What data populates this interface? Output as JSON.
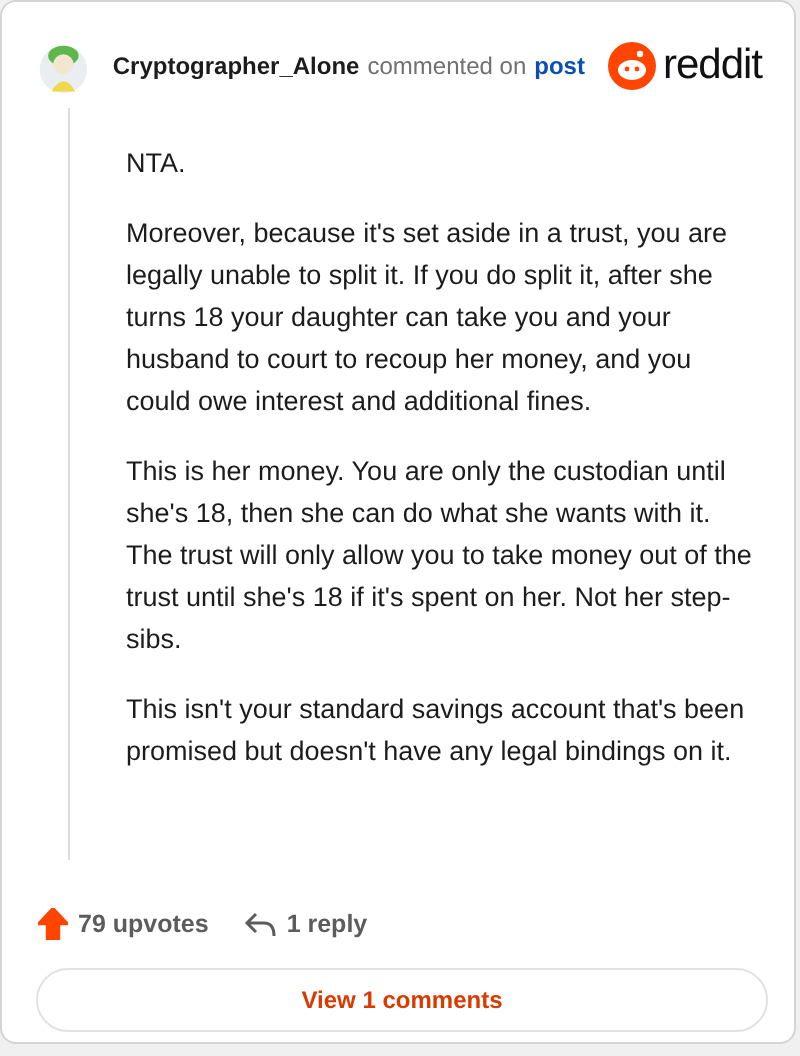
{
  "header": {
    "username": "Cryptographer_Alone",
    "action": "commented on",
    "link": "post",
    "brand": "reddit"
  },
  "paragraphs": [
    "NTA.",
    "Moreover, because it's set aside in a trust, you are legally unable to split it. If you do split it, after she turns 18 your daughter can take you and your husband to court to recoup her money, and you could owe interest and additional fines.",
    "This is her money. You are only the custodian until she's 18, then she can do what she wants with it. The trust will only allow you to take money out of the trust until she's 18 if it's spent on her. Not her step-sibs.",
    "This isn't your standard savings account that's been promised but doesn't have any legal bindings on it."
  ],
  "footer": {
    "upvotes": "79 upvotes",
    "upvoted": true,
    "replies": "1 reply"
  },
  "view_button": "View 1 comments"
}
